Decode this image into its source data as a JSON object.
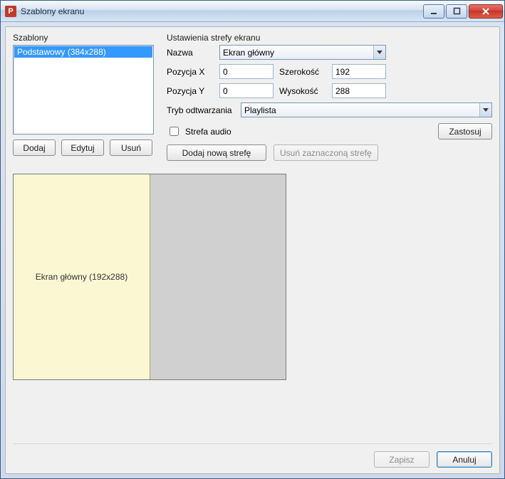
{
  "window": {
    "title": "Szablony ekranu",
    "icon_letter": "P"
  },
  "templates": {
    "label": "Szablony",
    "items": [
      "Podstawowy (384x288)"
    ],
    "buttons": {
      "add": "Dodaj",
      "edit": "Edytuj",
      "delete": "Usuń"
    }
  },
  "zone_settings": {
    "label": "Ustawienia strefy ekranu",
    "name_label": "Nazwa",
    "name_value": "Ekran główny",
    "posx_label": "Pozycja X",
    "posx_value": "0",
    "width_label": "Szerokość",
    "width_value": "192",
    "posy_label": "Pozycja Y",
    "posy_value": "0",
    "height_label": "Wysokość",
    "height_value": "288",
    "playmode_label": "Tryb odtwarzania",
    "playmode_value": "Playlista",
    "audio_label": "Strefa audio",
    "apply": "Zastosuj"
  },
  "zone_buttons": {
    "add": "Dodaj nową strefę",
    "delete": "Usuń zaznaczoną strefę"
  },
  "preview": {
    "zone_label": "Ekran główny (192x288)"
  },
  "footer": {
    "save": "Zapisz",
    "cancel": "Anuluj"
  }
}
